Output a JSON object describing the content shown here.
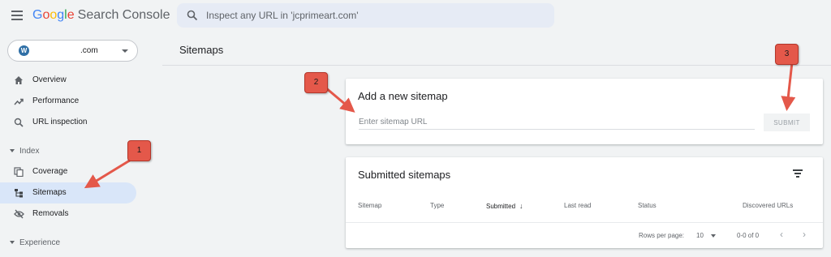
{
  "header": {
    "app_brand": "Google",
    "app_product": "Search Console",
    "brand_colors": [
      "#4285F4",
      "#EA4335",
      "#FBBC05",
      "#4285F4",
      "#34A853",
      "#EA4335"
    ],
    "search_placeholder": "Inspect any URL in 'jcprimeart.com'"
  },
  "property": {
    "domain": ".com"
  },
  "sidebar": {
    "items": [
      {
        "label": "Overview",
        "icon": "home-icon"
      },
      {
        "label": "Performance",
        "icon": "trending-up-icon"
      },
      {
        "label": "URL inspection",
        "icon": "search-icon"
      },
      {
        "label": "Coverage",
        "icon": "coverage-icon"
      },
      {
        "label": "Sitemaps",
        "icon": "sitemap-icon",
        "active": true
      },
      {
        "label": "Removals",
        "icon": "visibility-off-icon"
      }
    ],
    "sections": [
      "Index",
      "Experience"
    ]
  },
  "main": {
    "page_title": "Sitemaps",
    "add_card": {
      "title": "Add a new sitemap",
      "input_placeholder": "Enter sitemap URL",
      "submit_label": "SUBMIT"
    },
    "submitted_card": {
      "title": "Submitted sitemaps",
      "columns": [
        "Sitemap",
        "Type",
        "Submitted",
        "Last read",
        "Status",
        "Discovered URLs"
      ],
      "rows_per_page_label": "Rows per page:",
      "rows_per_page_value": "10",
      "range_text": "0-0 of 0"
    }
  },
  "annotations": {
    "badges": [
      "1",
      "2",
      "3"
    ],
    "color": "#e4584a"
  }
}
